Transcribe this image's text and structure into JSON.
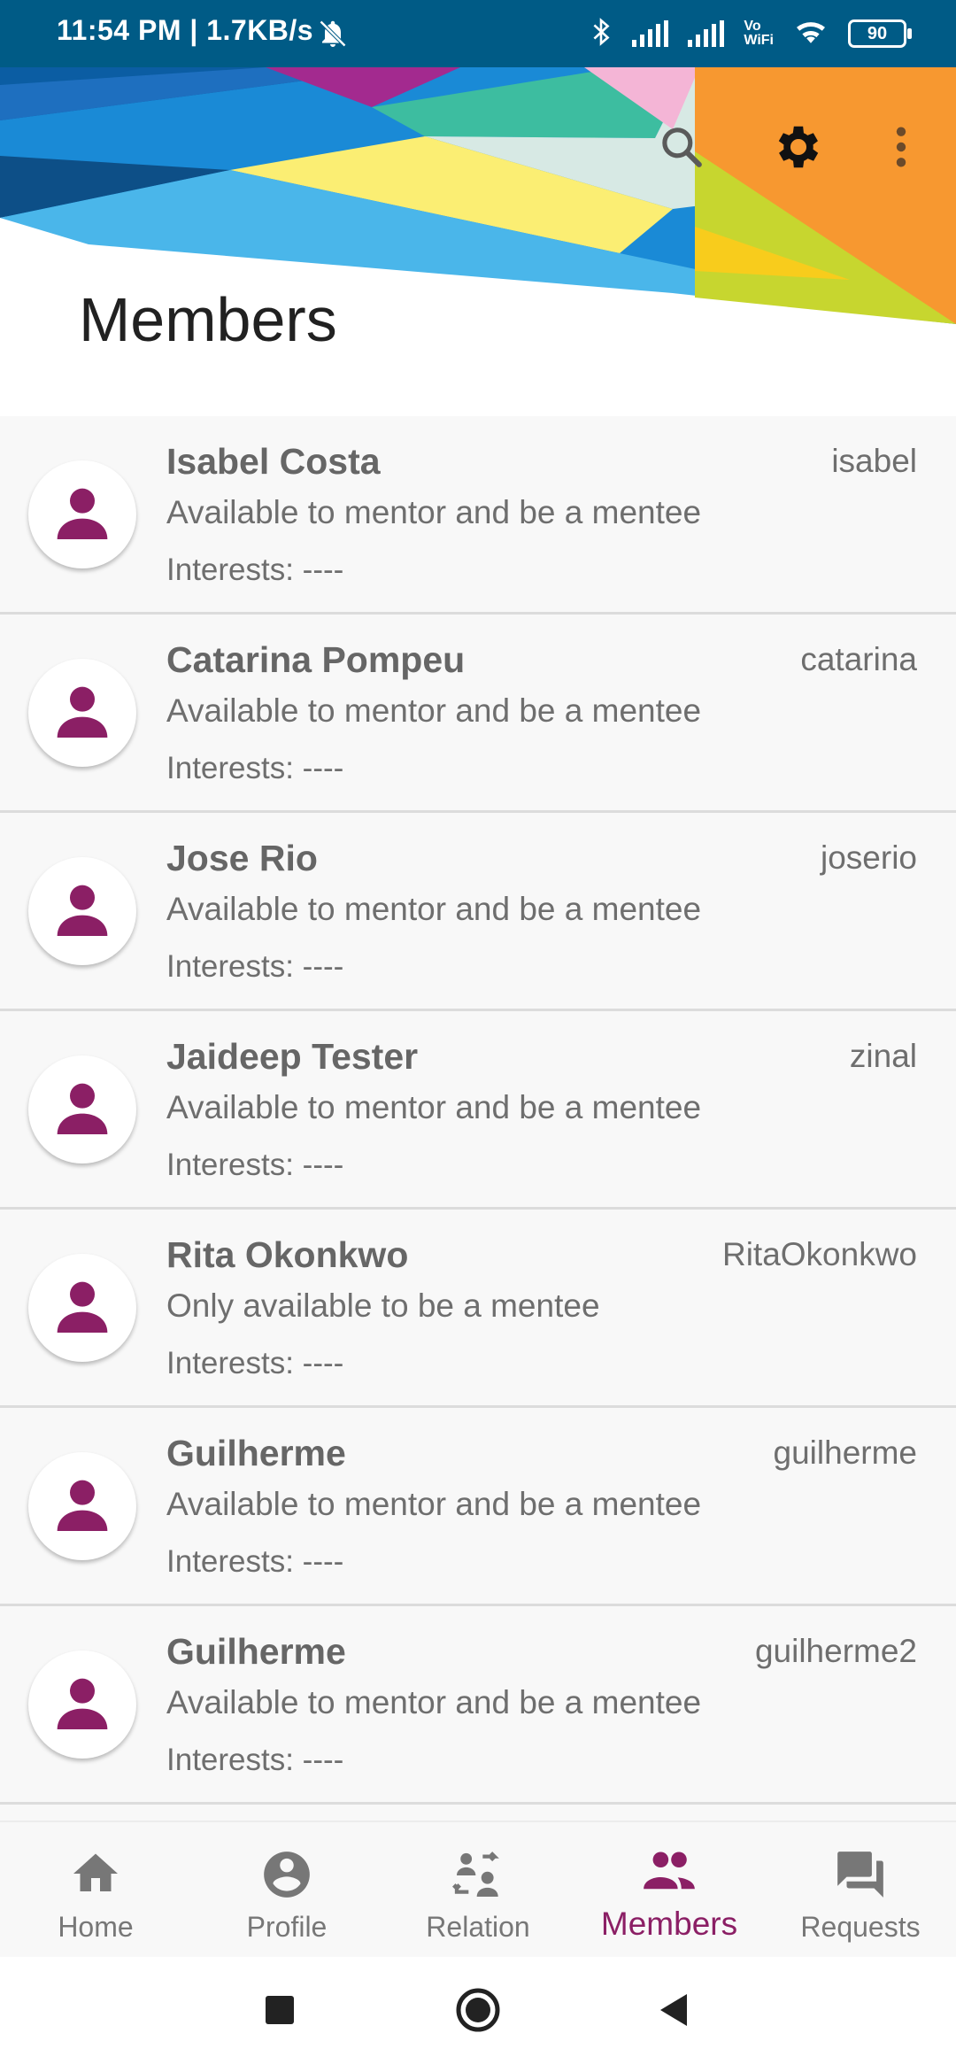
{
  "status_bar": {
    "time": "11:54 PM | 1.7KB/s",
    "battery": "90"
  },
  "header": {
    "title": "Members",
    "icons": [
      "search-icon",
      "settings-gear-icon",
      "more-vertical-icon"
    ]
  },
  "members": [
    {
      "name": "Isabel Costa",
      "username": "isabel",
      "availability": "Available to mentor and be a mentee",
      "interests": "Interests: ----"
    },
    {
      "name": "Catarina Pompeu",
      "username": "catarina",
      "availability": "Available to mentor and be a mentee",
      "interests": "Interests: ----"
    },
    {
      "name": "Jose Rio",
      "username": "joserio",
      "availability": "Available to mentor and be a mentee",
      "interests": "Interests: ----"
    },
    {
      "name": "Jaideep Tester",
      "username": "zinal",
      "availability": "Available to mentor and be a mentee",
      "interests": "Interests: ----"
    },
    {
      "name": "Rita Okonkwo",
      "username": "RitaOkonkwo",
      "availability": "Only available to be a mentee",
      "interests": "Interests: ----"
    },
    {
      "name": "Guilherme",
      "username": "guilherme",
      "availability": "Available to mentor and be a mentee",
      "interests": "Interests: ----"
    },
    {
      "name": "Guilherme",
      "username": "guilherme2",
      "availability": "Available to mentor and be a mentee",
      "interests": "Interests: ----"
    }
  ],
  "bottom_nav": [
    {
      "label": "Home",
      "icon": "home-icon",
      "active": false
    },
    {
      "label": "Profile",
      "icon": "account-circle-icon",
      "active": false
    },
    {
      "label": "Relation",
      "icon": "relation-icon",
      "active": false
    },
    {
      "label": "Members",
      "icon": "group-icon",
      "active": true
    },
    {
      "label": "Requests",
      "icon": "forum-icon",
      "active": false
    }
  ],
  "colors": {
    "accent": "#8b1f65",
    "status_bar": "#005b86",
    "text_secondary": "#6e6e6e"
  }
}
